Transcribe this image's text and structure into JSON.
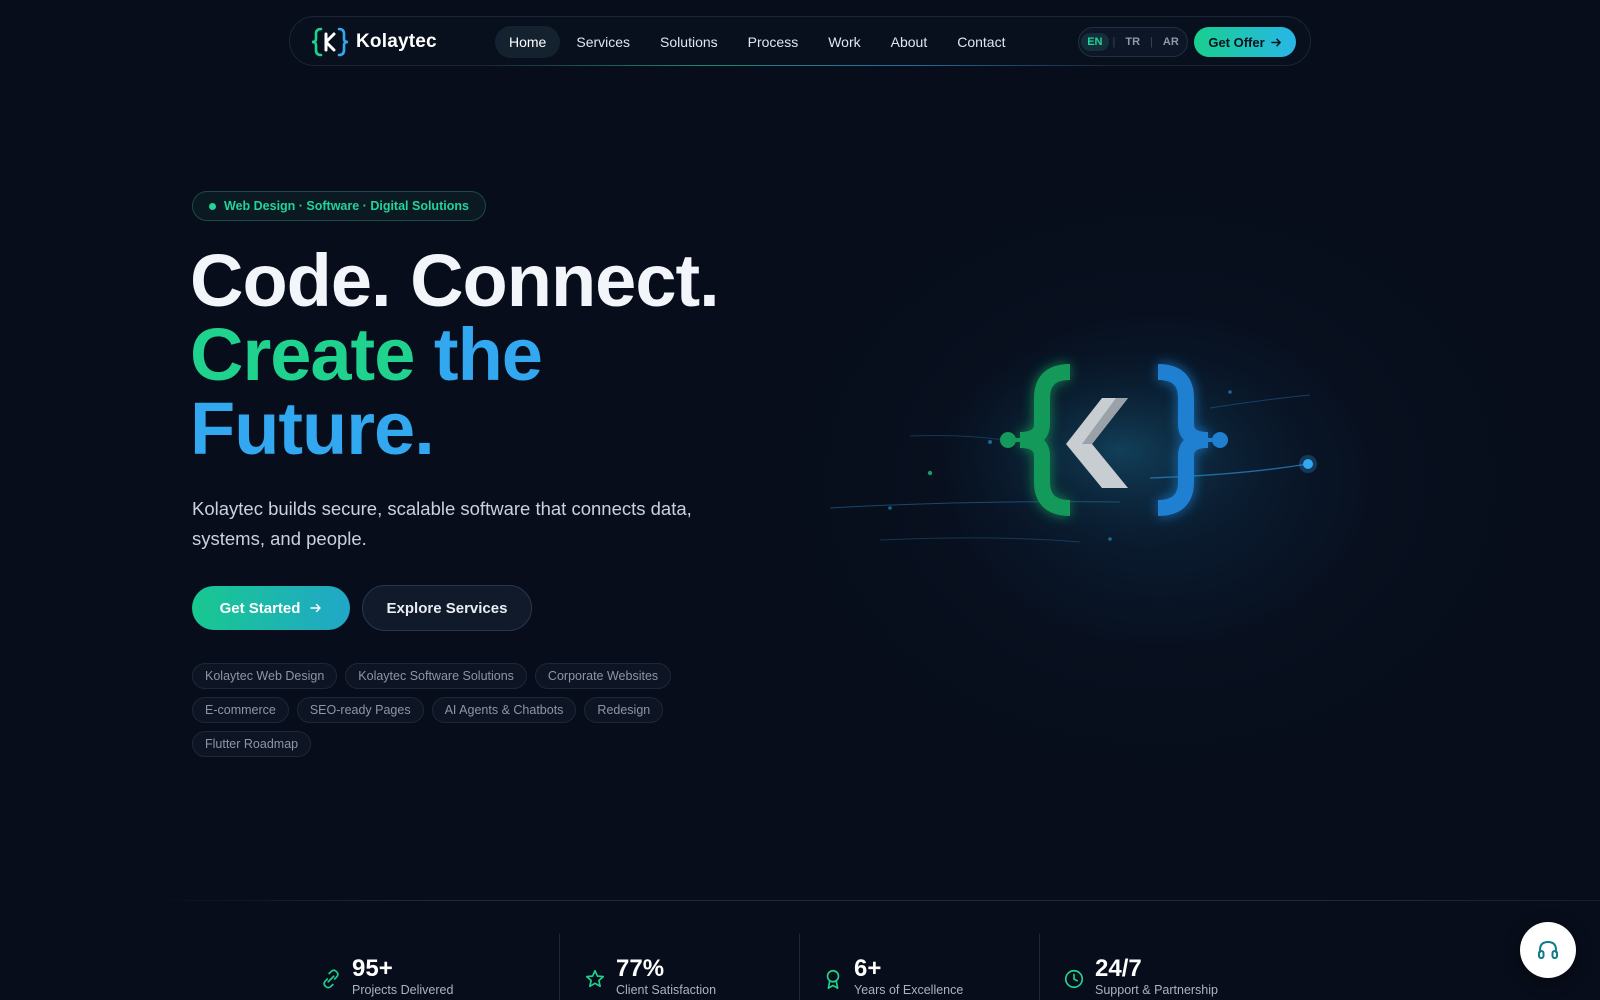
{
  "brand": {
    "name": "Kolaytec",
    "logo_icon": "braces-k-logo-icon"
  },
  "nav": {
    "links": [
      "Home",
      "Services",
      "Solutions",
      "Process",
      "Work",
      "About",
      "Contact"
    ],
    "active": "Home",
    "languages": [
      "EN",
      "TR",
      "AR"
    ],
    "active_language": "EN",
    "cta_label": "Get Offer"
  },
  "hero": {
    "badge": "Web Design · Software · Digital Solutions",
    "line1": "Code. Connect.",
    "line2_green": "Create",
    "line2_blue": "the",
    "line3": "Future.",
    "subtitle": "Kolaytec builds secure, scalable software that connects data, systems, and people.",
    "primary_button": "Get Started",
    "secondary_button": "Explore Services",
    "tags": [
      "Kolaytec Web Design",
      "Kolaytec Software Solutions",
      "Corporate Websites",
      "E-commerce",
      "SEO-ready Pages",
      "AI Agents & Chatbots",
      "Redesign",
      "Flutter Roadmap"
    ]
  },
  "stats": [
    {
      "value": "95+",
      "label": "Projects Delivered",
      "icon": "link-icon"
    },
    {
      "value": "77%",
      "label": "Client Satisfaction",
      "icon": "star-icon"
    },
    {
      "value": "6+",
      "label": "Years of Excellence",
      "icon": "award-icon"
    },
    {
      "value": "24/7",
      "label": "Support & Partnership",
      "icon": "clock-icon"
    }
  ],
  "colors": {
    "background": "#070d1a",
    "accent_green": "#1fd38e",
    "accent_blue": "#32a8f0",
    "logo_green": "#139a5a",
    "logo_blue": "#1f7fd0",
    "logo_k": "#c8cdd2"
  },
  "support": {
    "icon": "headset-icon"
  }
}
